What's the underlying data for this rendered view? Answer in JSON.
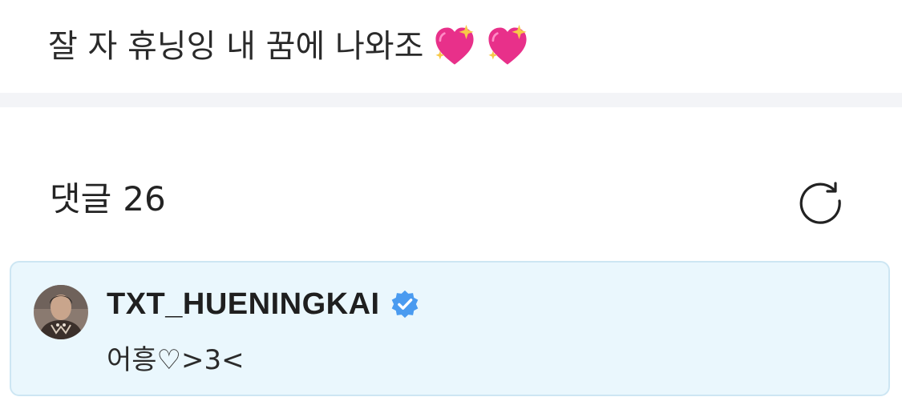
{
  "post": {
    "text": "잘 자 휴닝잉 내 꿈에 나와조",
    "emojis": [
      "sparkling-heart",
      "sparkling-heart"
    ]
  },
  "comments": {
    "label": "댓글",
    "count": "26",
    "refresh_icon": "refresh-icon"
  },
  "comment": {
    "author": "TXT_HUENINGKAI",
    "verified": true,
    "verified_icon": "verified-badge-icon",
    "text": "어흥♡>3<"
  },
  "colors": {
    "card_background": "#eaf7fd",
    "card_border": "#cde6f3",
    "verified_blue": "#4a9bf0",
    "heart_pink": "#e8308a",
    "sparkle_yellow": "#f7c948",
    "divider": "#f3f4f7"
  }
}
